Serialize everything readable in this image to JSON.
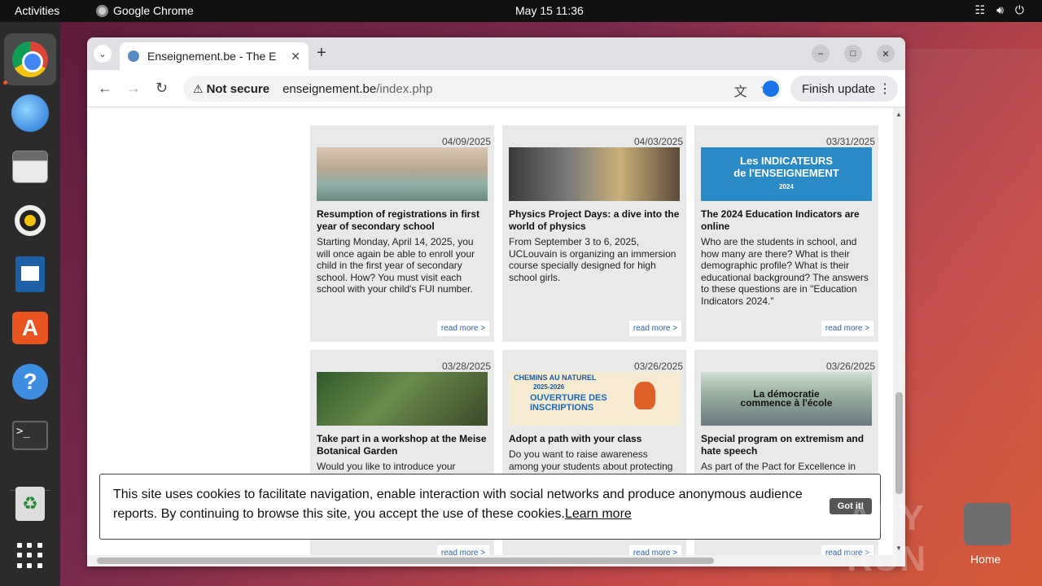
{
  "topbar": {
    "activities": "Activities",
    "app_name": "Google Chrome",
    "datetime": "May 15  11:36"
  },
  "desktop": {
    "home_label": "Home",
    "watermark": "ANY RUN"
  },
  "browser": {
    "tab_title": "Enseignement.be - The E",
    "security_label": "Not secure",
    "url_domain": "enseignement.be",
    "url_path": "/index.php",
    "finish_update": "Finish update"
  },
  "cards": [
    {
      "date": "04/09/2025",
      "title": "Resumption of registrations in first year of secondary school",
      "body": "Starting Monday, April 14, 2025, you will once again be able to enroll your child in the first year of secondary school. How? You must visit each school with your child's FUI number.",
      "read_more": "read more >"
    },
    {
      "date": "04/03/2025",
      "title": "Physics Project Days: a dive into the world of physics",
      "body": "From September 3 to 6, 2025, UCLouvain is organizing an immersion course specially designed for high school girls.",
      "read_more": "read more >"
    },
    {
      "date": "03/31/2025",
      "title": "The 2024 Education Indicators are online",
      "body": "Who are the students in school, and how many are there? What is their demographic profile? What is their educational background? The answers to these questions are in \"Education Indicators 2024.\"",
      "read_more": "read more >",
      "image_text_1": "Les INDICATEURS",
      "image_text_2": "de l'ENSEIGNEMENT",
      "image_text_3": "2024"
    },
    {
      "date": "03/28/2025",
      "title": "Take part in a workshop at the Meise Botanical Garden",
      "body": "Would you like to introduce your",
      "read_more": "read more >"
    },
    {
      "date": "03/26/2025",
      "title": "Adopt a path with your class",
      "body": "Do you want to raise awareness among your students about protecting",
      "read_more": "read more >",
      "image_text_1": "CHEMINS AU NATUREL",
      "image_text_2": "2025-2026",
      "image_text_3": "OUVERTURE DES INSCRIPTIONS"
    },
    {
      "date": "03/26/2025",
      "title": "Special program on extremism and hate speech",
      "body": "As part of the Pact for Excellence in",
      "read_more": "read more >",
      "image_text_1": "La démocratie commence à l'école"
    }
  ],
  "cookie": {
    "text": "This site uses cookies to facilitate navigation, enable interaction with social networks and produce anonymous audience reports. By continuing to browse this site, you accept the use of these cookies.",
    "learn_more": "Learn more",
    "got_it": "Got it!"
  }
}
